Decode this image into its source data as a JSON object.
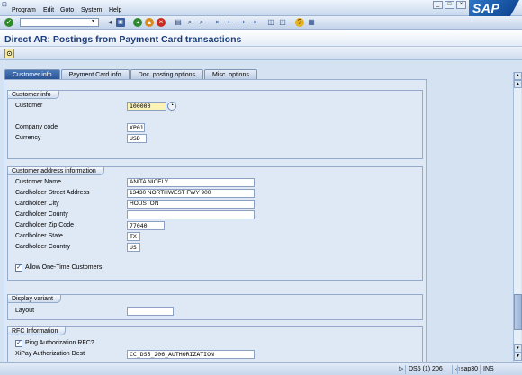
{
  "menu": [
    "Program",
    "Edit",
    "Goto",
    "System",
    "Help"
  ],
  "window_controls": [
    "_",
    "□",
    "×"
  ],
  "brand": "SAP",
  "toolbar": {
    "command_value": "",
    "icons": [
      "save-icon",
      "back-icon",
      "exit-icon",
      "cancel-icon",
      "print-icon",
      "find-icon",
      "find-next-icon",
      "first-page-icon",
      "previous-page-icon",
      "next-page-icon",
      "last-page-icon",
      "create-session-icon",
      "shortcut-icon",
      "help-icon",
      "layout-icon"
    ]
  },
  "title": "Direct AR: Postings from Payment Card transactions",
  "tabs": [
    "Customer info",
    "Payment Card info",
    "Doc. posting options",
    "Misc. options"
  ],
  "active_tab": 0,
  "groups": {
    "customer_info": {
      "header": "Customer info",
      "customer_label": "Customer",
      "customer_value": "100000",
      "company_code_label": "Company code",
      "company_code_value": "XP01",
      "currency_label": "Currency",
      "currency_value": "USD"
    },
    "address": {
      "header": "Customer address information",
      "name_label": "Customer Name",
      "name_value": "ANITA NICELY",
      "street_label": "Cardholder Street Address",
      "street_value": "13430 NORTHWEST FWY 900",
      "city_label": "Cardholder City",
      "city_value": "HOUSTON",
      "county_label": "Cardholder County",
      "county_value": "",
      "zip_label": "Cardholder Zip Code",
      "zip_value": "77040",
      "state_label": "Cardholder State",
      "state_value": "TX",
      "country_label": "Cardholder Country",
      "country_value": "US",
      "allow_onetime_label": "Allow One-Time Customers",
      "allow_onetime_checked": true
    },
    "display_variant": {
      "header": "Display variant",
      "layout_label": "Layout",
      "layout_value": ""
    },
    "rfc": {
      "header": "RFC Information",
      "ping_label": "Ping Authorization RFC?",
      "ping_checked": true,
      "xipay_label": "XiPay Authorization Dest",
      "xipay_value": "CC_DS5_206_AUTHORIZATION"
    }
  },
  "status": {
    "system": "DS5 (1) 206",
    "server": "sap30",
    "mode": "INS"
  },
  "colors": {
    "title": "#1c3d78",
    "active_tab": "#2a5595",
    "required_field": "#fbf2b6",
    "background": "#d4e2f2"
  }
}
